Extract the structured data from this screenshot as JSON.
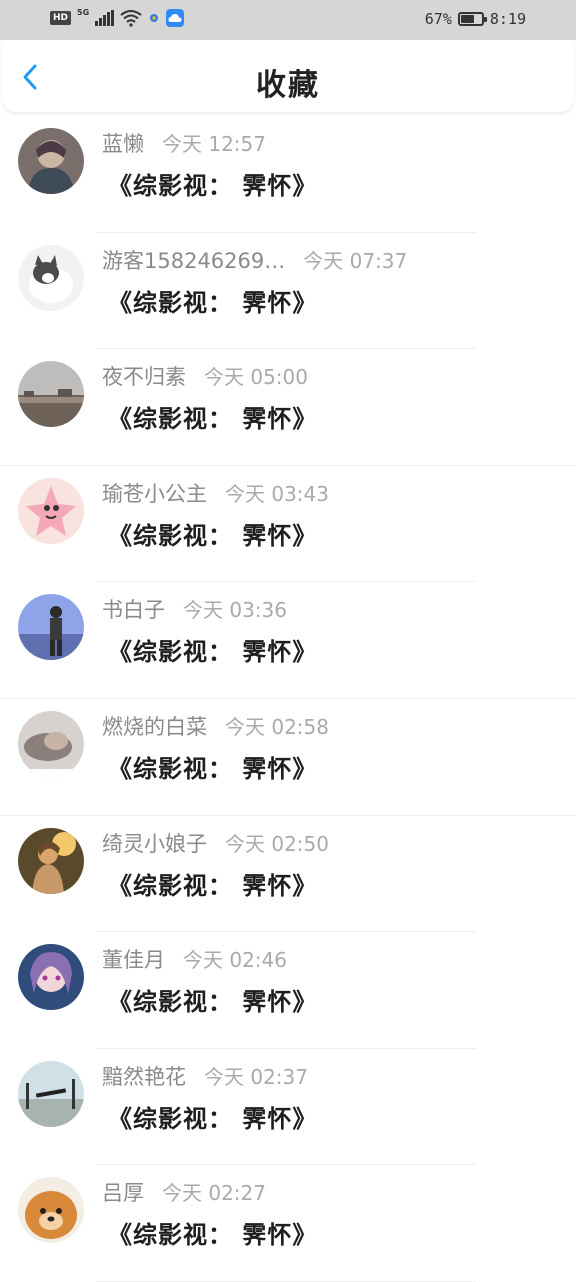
{
  "status_bar": {
    "hd": "HD",
    "network": "5G",
    "battery": "67%",
    "battery_level": 0.67,
    "time": "8:19"
  },
  "header": {
    "back_icon": "chevron-left-icon",
    "title": "收藏"
  },
  "colors": {
    "accent": "#1f9bf0",
    "status_bar_bg": "#d6d6d6"
  },
  "items": [
    {
      "name": "蓝懒",
      "time": "今天 12:57",
      "title": "《综影视： 霁怀》",
      "avatar_icon": "avatar-anime-icon"
    },
    {
      "name": "游客158246269…",
      "time": "今天 07:37",
      "title": "《综影视： 霁怀》",
      "avatar_icon": "avatar-cat-icon"
    },
    {
      "name": "夜不归素",
      "time": "今天 05:00",
      "title": "《综影视： 霁怀》",
      "avatar_icon": "avatar-landscape-icon"
    },
    {
      "name": "瑜苍小公主",
      "time": "今天 03:43",
      "title": "《综影视： 霁怀》",
      "avatar_icon": "avatar-starfish-icon"
    },
    {
      "name": "书白子",
      "time": "今天 03:36",
      "title": "《综影视： 霁怀》",
      "avatar_icon": "avatar-person-sky-icon"
    },
    {
      "name": "燃烧的白菜",
      "time": "今天 02:58",
      "title": "《综影视： 霁怀》",
      "avatar_icon": "avatar-sleeping-icon"
    },
    {
      "name": "绮灵小娘子",
      "time": "今天 02:50",
      "title": "《综影视： 霁怀》",
      "avatar_icon": "avatar-girl-sunset-icon"
    },
    {
      "name": "董佳月",
      "time": "今天 02:46",
      "title": "《综影视： 霁怀》",
      "avatar_icon": "avatar-anime-girl-icon"
    },
    {
      "name": "黯然艳花",
      "time": "今天 02:37",
      "title": "《综影视： 霁怀》",
      "avatar_icon": "avatar-beach-icon"
    },
    {
      "name": "吕厚",
      "time": "今天 02:27",
      "title": "《综影视： 霁怀》",
      "avatar_icon": "avatar-dog-icon"
    }
  ]
}
